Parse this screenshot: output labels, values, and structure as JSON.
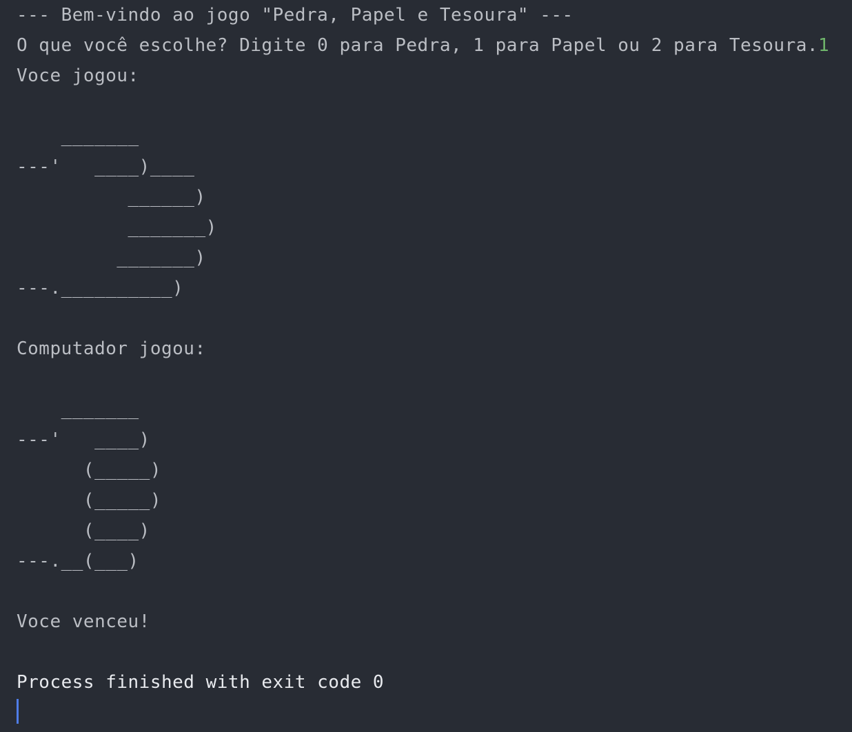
{
  "console": {
    "welcome": "--- Bem-vindo ao jogo \"Pedra, Papel e Tesoura\" ---",
    "prompt": "O que você escolhe? Digite 0 para Pedra, 1 para Papel ou 2 para Tesoura.",
    "user_input": "1",
    "player_label": "Voce jogou:",
    "player_art": [
      "",
      "    _______",
      "---'   ____)____",
      "          ______)",
      "          _______)",
      "         _______)",
      "---.__________)"
    ],
    "computer_label": "Computador jogou:",
    "computer_art": [
      "",
      "    _______",
      "---'   ____)",
      "      (_____)",
      "      (_____)",
      "      (____)",
      "---.__(___)"
    ],
    "result": "Voce venceu!",
    "process_status": "Process finished with exit code 0"
  }
}
